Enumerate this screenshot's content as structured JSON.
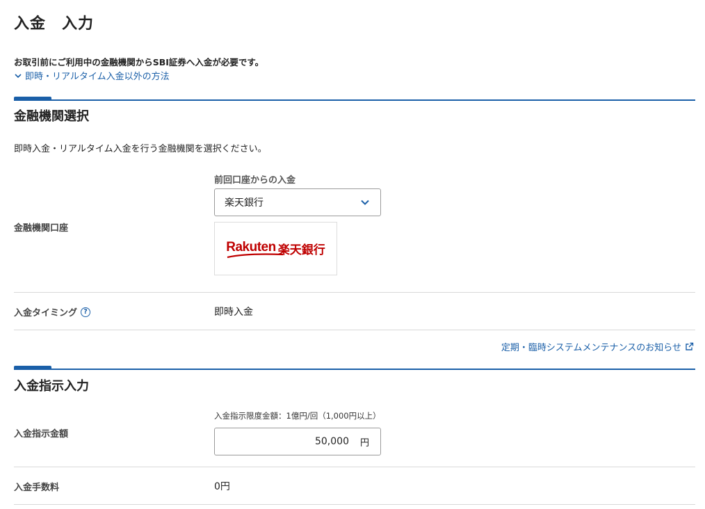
{
  "page": {
    "title": "入金　入力"
  },
  "intro": {
    "notice": "お取引前にご利用中の金融機関からSBI証券へ入金が必要です。",
    "other_method_link": "即時・リアルタイム入金以外の方法"
  },
  "bank_section": {
    "title": "金融機関選択",
    "description": "即時入金・リアルタイム入金を行う金融機関を選択ください。",
    "account_label": "金融機関口座",
    "previous_caption": "前回口座からの入金",
    "selected_bank": "楽天銀行",
    "logo": {
      "en": "Rakuten",
      "jp": "楽天銀行",
      "color": "#bf0000"
    },
    "timing_label": "入金タイミング",
    "timing_value": "即時入金",
    "maintenance_link": "定期・臨時システムメンテナンスのお知らせ"
  },
  "instruction_section": {
    "title": "入金指示入力",
    "amount_label": "入金指示金額",
    "limit_caption": "入金指示限度金額：1億円/回（1,000円以上）",
    "amount_value": "50,000",
    "amount_unit": "円",
    "fee_label": "入金手数料",
    "fee_value": "0円"
  },
  "colors": {
    "accent": "#1a5fa8",
    "divider": "#d8d8d8"
  },
  "icons": {
    "other_method": "chevron-down-icon",
    "select": "chevron-down-icon",
    "help": "question-circle-icon",
    "external": "external-link-icon"
  }
}
